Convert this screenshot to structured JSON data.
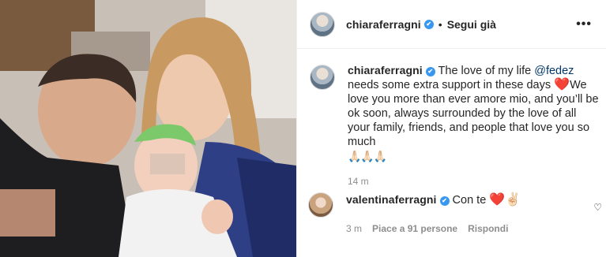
{
  "post": {
    "author": "chiaraferragni",
    "follow_status": "Segui già",
    "separator": "•",
    "more_label": "•••"
  },
  "caption": {
    "username": "chiaraferragni",
    "text_before_mention": " The love of my life ",
    "mention": "@fedez",
    "text_after_mention": " needs some extra support in these days ",
    "heart": "❤️",
    "text_rest": "We love you more than ever amore mio, and you’ll be ok soon, always surrounded by the love of all your family, friends, and people that love you so much",
    "hands": "🙏🏻🙏🏻🙏🏻",
    "time": "14 m"
  },
  "comment": {
    "username": "valentinaferragni",
    "text": " Con te ",
    "emoji": "❤️✌🏻",
    "time": "3 m",
    "likes": "Piace a 91 persone",
    "reply": "Rispondi",
    "like_icon": "♡"
  },
  "icons": {
    "verified": "✔"
  }
}
